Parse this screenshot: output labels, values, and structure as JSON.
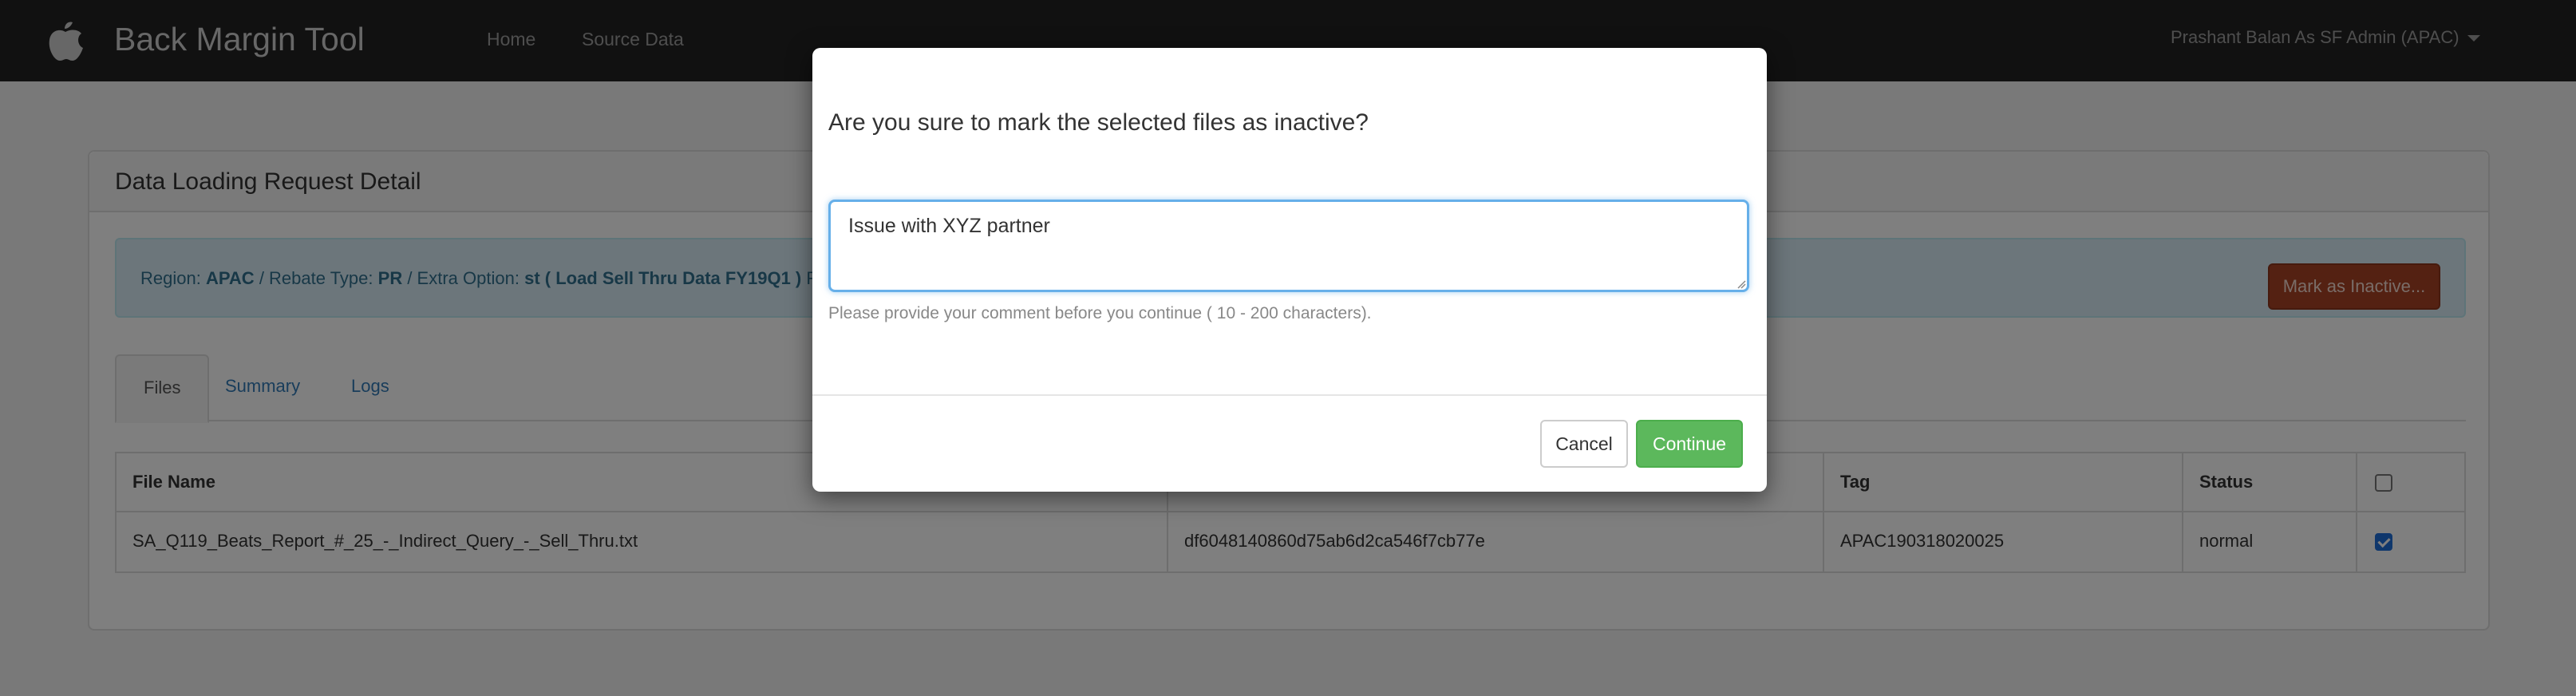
{
  "navbar": {
    "app_title": "Back Margin Tool",
    "logo_icon": "apple-icon",
    "links": [
      "Home",
      "Source Data"
    ],
    "user_menu": "Prashant Balan As SF Admin (APAC)"
  },
  "panel": {
    "title": "Data Loading Request Detail",
    "info": {
      "region_label": "Region:",
      "region_value": "APAC",
      "rebate_label": "/ Rebate Type:",
      "rebate_value": "PR",
      "extra_label": "/ Extra Option:",
      "extra_value": "st ( Load Sell Thru Data FY19Q1 )",
      "trailing": "Req"
    },
    "mark_inactive_button": "Mark as Inactive..."
  },
  "tabs": [
    {
      "label": "Files",
      "active": true
    },
    {
      "label": "Summary",
      "active": false
    },
    {
      "label": "Logs",
      "active": false
    }
  ],
  "table": {
    "headers": [
      "File Name",
      "",
      "Tag",
      "Status",
      ""
    ],
    "rows": [
      {
        "file_name": "SA_Q119_Beats_Report_#_25_-_Indirect_Query_-_Sell_Thru.txt",
        "hash": "df6048140860d75ab6d2ca546f7cb77e",
        "tag": "APAC190318020025",
        "status": "normal",
        "checked": true
      }
    ],
    "header_checked": false
  },
  "modal": {
    "question": "Are you sure to mark the selected files as inactive?",
    "comment_value": "Issue with XYZ partner",
    "help_text": "Please provide your comment before you continue ( 10 - 200 characters).",
    "cancel_label": "Cancel",
    "continue_label": "Continue"
  },
  "colors": {
    "navbar_bg": "#222222",
    "info_bg": "#d9edf7",
    "danger_button": "#a94224",
    "success_button": "#5cb85c",
    "focus_border": "#66afe9"
  }
}
